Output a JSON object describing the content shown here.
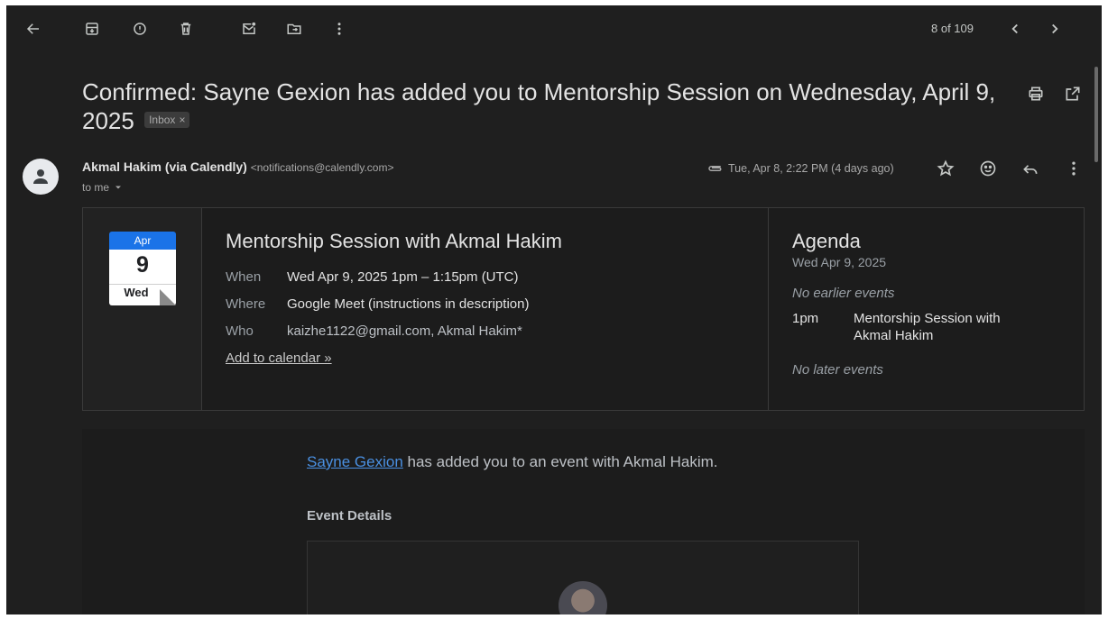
{
  "toolbar": {
    "back": "arrow-left-icon",
    "archive": "archive-icon",
    "report_spam": "report-spam-icon",
    "delete": "trash-icon",
    "mark_unread": "mark-unread-icon",
    "move_to": "move-to-icon",
    "more": "more-vert-icon",
    "page_count": "8 of 109",
    "newer": "chevron-left-icon",
    "older": "chevron-right-icon"
  },
  "subject": {
    "text": "Confirmed: Sayne Gexion has added you to Mentorship Session on Wednesday, April 9, 2025",
    "label_chip": "Inbox",
    "label_remove": "×",
    "print": "print-icon",
    "open_new_window": "open-in-new-icon"
  },
  "message": {
    "sender_name": "Akmal Hakim (via Calendly)",
    "sender_email": "<notifications@calendly.com>",
    "recipient": "to me",
    "date": "Tue, Apr 8, 2:22 PM (4 days ago)",
    "attachment_icon": "paperclip-icon",
    "star_icon": "star-icon",
    "emoji_icon": "emoji-icon",
    "reply_icon": "reply-icon",
    "more_icon": "more-vert-icon"
  },
  "invite": {
    "calendar_month": "Apr",
    "calendar_day": "9",
    "calendar_weekday": "Wed",
    "title": "Mentorship Session with Akmal Hakim",
    "when_label": "When",
    "when_value": "Wed Apr 9, 2025 1pm – 1:15pm (UTC)",
    "where_label": "Where",
    "where_value": "Google Meet (instructions in description)",
    "who_label": "Who",
    "who_value": "kaizhe1122@gmail.com, Akmal Hakim*",
    "add_to_calendar": "Add to calendar »",
    "agenda_title": "Agenda",
    "agenda_date": "Wed Apr 9, 2025",
    "no_earlier": "No earlier events",
    "event_time": "1pm",
    "event_name": "Mentorship Session with Akmal Hakim",
    "no_later": "No later events"
  },
  "body": {
    "link_name": "Sayne Gexion",
    "text_rest": " has added you to an event with Akmal Hakim.",
    "event_details_heading": "Event Details"
  },
  "colors": {
    "background": "#1f1f1f",
    "calendar_blue": "#1a73e8",
    "link_blue": "#4a90e2"
  }
}
